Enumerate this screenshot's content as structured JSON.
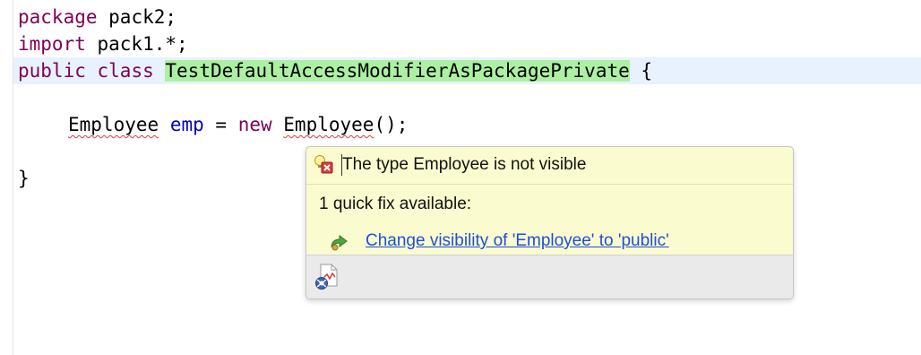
{
  "editor": {
    "lines": [
      {
        "keyword": "package",
        "rest": " pack2;"
      },
      {
        "keyword": "import",
        "rest": " pack1.*;"
      },
      {
        "keyword": "public",
        "keyword2": "class",
        "class_name": "TestDefaultAccessModifierAsPackagePrivate",
        "tail": " {"
      },
      {
        "type1": "Employee",
        "var": "emp",
        "op": " = ",
        "keyword": "new",
        "type2": "Employee",
        "tail": "();"
      },
      {
        "text": "}"
      }
    ],
    "current_line": 3
  },
  "hover_popup": {
    "problem_text": "The type Employee is not visible",
    "quickfix_count": "1 quick fix available:",
    "fix_label": "Change visibility of 'Employee' to 'public'",
    "icons": {
      "problem": "error-lightbulb-icon",
      "fix": "change-visibility-icon",
      "toolbar": "configure-problem-severity-icon"
    }
  },
  "colors": {
    "keyword": "#7f0055",
    "field": "#0000c0",
    "class_highlight": "#acf0a2",
    "current_line": "#e8f2fe",
    "popup_background": "#fbfbd0",
    "link": "#1e4fd8",
    "error_squiggle": "#e03a3a"
  }
}
